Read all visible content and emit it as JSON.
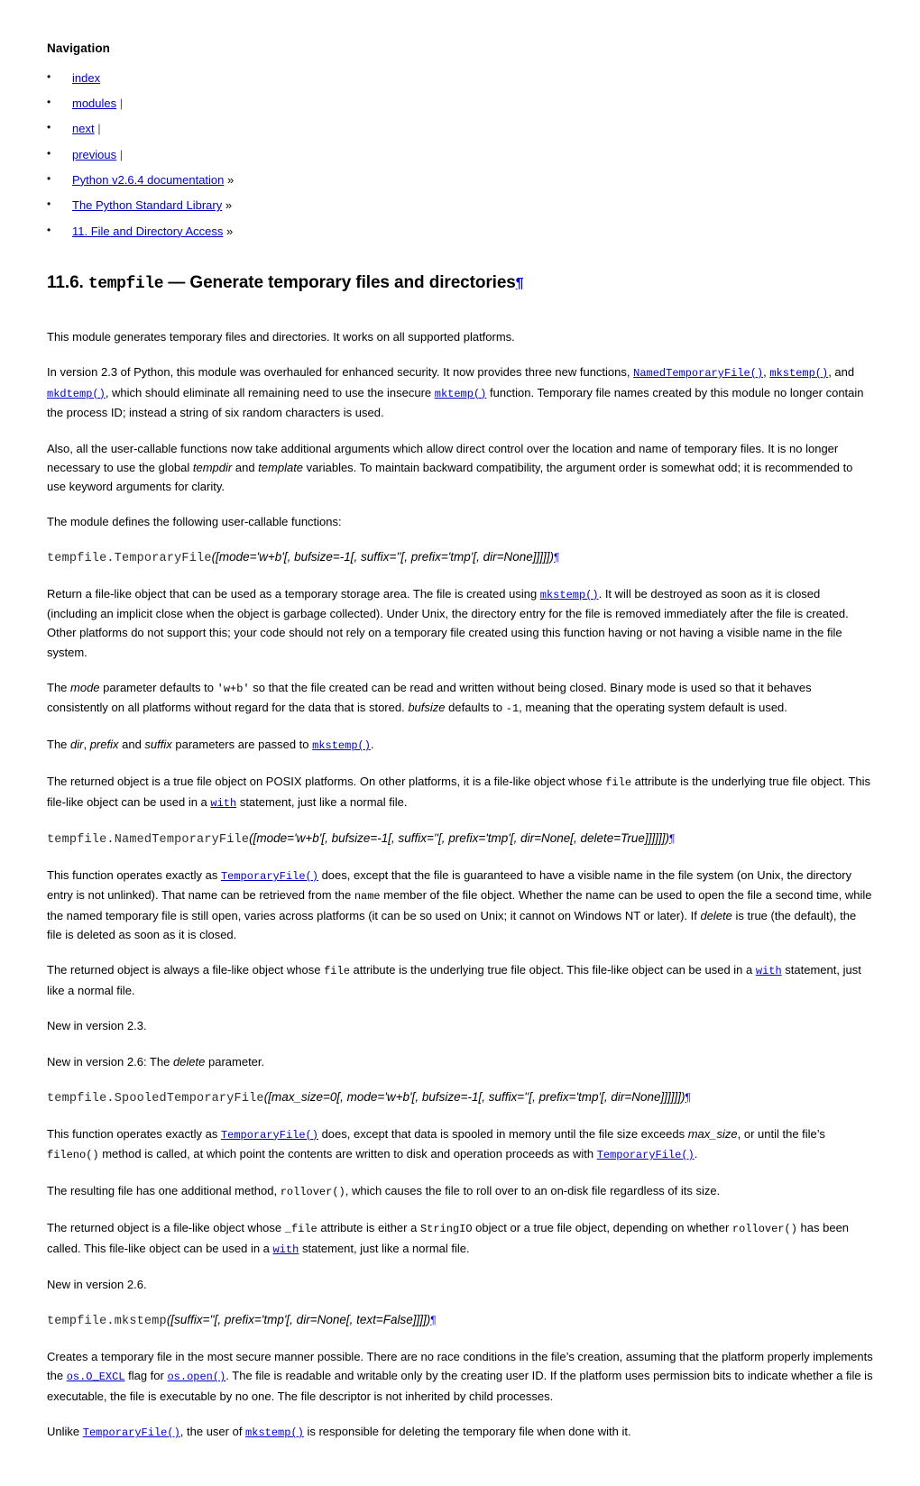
{
  "nav": {
    "title": "Navigation",
    "items": [
      {
        "label": "index",
        "trail": ""
      },
      {
        "label": "modules",
        "trail": "|"
      },
      {
        "label": "next",
        "trail": "|"
      },
      {
        "label": "previous",
        "trail": "|"
      },
      {
        "label": "Python v2.6.4 documentation",
        "trail": "»"
      },
      {
        "label": "The Python Standard Library",
        "trail": "»"
      },
      {
        "label": "11. File and Directory Access",
        "trail": "»"
      }
    ]
  },
  "heading": {
    "number": "11.6.",
    "module": "tempfile",
    "dash": "—",
    "rest": "Generate temporary files and directories",
    "pilcrow": "¶"
  },
  "colors": {
    "link": "#0000cc",
    "text": "#000000",
    "background": "#ffffff",
    "signature_name": "#2b2b2b"
  },
  "intro": {
    "p1": "This module generates temporary files and directories. It works on all supported platforms.",
    "p2_a": "In version 2.3 of Python, this module was overhauled for enhanced security. It now provides three new functions, ",
    "p2_link1": "NamedTemporaryFile()",
    "p2_b": ", ",
    "p2_link2": "mkstemp()",
    "p2_c": ", and ",
    "p2_link3": "mkdtemp()",
    "p2_d": ", which should eliminate all remaining need to use the insecure ",
    "p2_link4": "mktemp()",
    "p2_e": " function. Temporary file names created by this module no longer contain the process ID; instead a string of six random characters is used.",
    "p3_a": "Also, all the user-callable functions now take additional arguments which allow direct control over the location and name of temporary files. It is no longer necessary to use the global ",
    "p3_em1": "tempdir",
    "p3_b": " and ",
    "p3_em2": "template",
    "p3_c": " variables. To maintain backward compatibility, the argument order is somewhat odd; it is recommended to use keyword arguments for clarity.",
    "p4": "The module defines the following user-callable functions:"
  },
  "temporaryfile": {
    "sig_name": "tempfile.TemporaryFile",
    "sig_args": "([mode='w+b'[, bufsize=-1[, suffix=''[, prefix='tmp'[, dir=None]]]]])",
    "pilcrow": "¶",
    "d1_a": "Return a file-like object that can be used as a temporary storage area. The file is created using ",
    "d1_link": "mkstemp()",
    "d1_b": ". It will be destroyed as soon as it is closed (including an implicit close when the object is garbage collected). Under Unix, the directory entry for the file is removed immediately after the file is created. Other platforms do not support this; your code should not rely on a temporary file created using this function having or not having a visible name in the file system.",
    "d2_a": "The ",
    "d2_em1": "mode",
    "d2_b": " parameter defaults to ",
    "d2_code1": "'w+b'",
    "d2_c": " so that the file created can be read and written without being closed. Binary mode is used so that it behaves consistently on all platforms without regard for the data that is stored. ",
    "d2_em2": "bufsize",
    "d2_d": " defaults to ",
    "d2_code2": "-1",
    "d2_e": ", meaning that the operating system default is used.",
    "d3_a": "The ",
    "d3_em1": "dir",
    "d3_b": ", ",
    "d3_em2": "prefix",
    "d3_c": " and ",
    "d3_em3": "suffix",
    "d3_d": " parameters are passed to ",
    "d3_link": "mkstemp()",
    "d3_e": ".",
    "d4_a": "The returned object is a true file object on POSIX platforms. On other platforms, it is a file-like object whose ",
    "d4_code1": "file",
    "d4_b": " attribute is the underlying true file object. This file-like object can be used in a ",
    "d4_link": "with",
    "d4_c": " statement, just like a normal file."
  },
  "namedtemporaryfile": {
    "sig_name": "tempfile.NamedTemporaryFile",
    "sig_args": "([mode='w+b'[, bufsize=-1[, suffix=''[, prefix='tmp'[, dir=None[, delete=True]]]]]])",
    "pilcrow": "¶",
    "d1_a": "This function operates exactly as ",
    "d1_link": "TemporaryFile()",
    "d1_b": " does, except that the file is guaranteed to have a visible name in the file system (on Unix, the directory entry is not unlinked). That name can be retrieved from the ",
    "d1_code1": "name",
    "d1_c": " member of the file object. Whether the name can be used to open the file a second time, while the named temporary file is still open, varies across platforms (it can be so used on Unix; it cannot on Windows NT or later). If ",
    "d1_em1": "delete",
    "d1_d": " is true (the default), the file is deleted as soon as it is closed.",
    "d2_a": "The returned object is always a file-like object whose ",
    "d2_code1": "file",
    "d2_b": " attribute is the underlying true file object. This file-like object can be used in a ",
    "d2_link": "with",
    "d2_c": " statement, just like a normal file.",
    "new23": "New in version 2.3.",
    "new26_a": "New in version 2.6: The ",
    "new26_em": "delete",
    "new26_b": " parameter."
  },
  "spooledtemporaryfile": {
    "sig_name": "tempfile.SpooledTemporaryFile",
    "sig_args": "([max_size=0[, mode='w+b'[, bufsize=-1[, suffix=''[, prefix='tmp'[, dir=None]]]]]])",
    "pilcrow": "¶",
    "d1_a": "This function operates exactly as ",
    "d1_link": "TemporaryFile()",
    "d1_b": " does, except that data is spooled in memory until the file size exceeds ",
    "d1_em1": "max_size",
    "d1_c": ", or until the file’s ",
    "d1_code1": "fileno()",
    "d1_d": " method is called, at which point the contents are written to disk and operation proceeds as with ",
    "d1_link2": "TemporaryFile()",
    "d1_e": ".",
    "d2_a": "The resulting file has one additional method, ",
    "d2_code1": "rollover()",
    "d2_b": ", which causes the file to roll over to an on-disk file regardless of its size.",
    "d3_a": "The returned object is a file-like object whose ",
    "d3_code1": "_file",
    "d3_b": " attribute is either a ",
    "d3_code2": "StringIO",
    "d3_c": " object or a true file object, depending on whether ",
    "d3_code3": "rollover()",
    "d3_d": " has been called. This file-like object can be used in a ",
    "d3_link": "with",
    "d3_e": " statement, just like a normal file.",
    "new26": "New in version 2.6."
  },
  "mkstemp": {
    "sig_name": "tempfile.mkstemp",
    "sig_args": "([suffix=''[, prefix='tmp'[, dir=None[, text=False]]]])",
    "pilcrow": "¶",
    "d1_a": "Creates a temporary file in the most secure manner possible. There are no race conditions in the file’s creation, assuming that the platform properly implements the ",
    "d1_link1": "os.O_EXCL",
    "d1_b": " flag for ",
    "d1_link2": "os.open()",
    "d1_c": ". The file is readable and writable only by the creating user ID. If the platform uses permission bits to indicate whether a file is executable, the file is executable by no one. The file descriptor is not inherited by child processes.",
    "d2_a": "Unlike ",
    "d2_link1": "TemporaryFile()",
    "d2_b": ", the user of ",
    "d2_link2": "mkstemp()",
    "d2_c": " is responsible for deleting the temporary file when done with it."
  }
}
